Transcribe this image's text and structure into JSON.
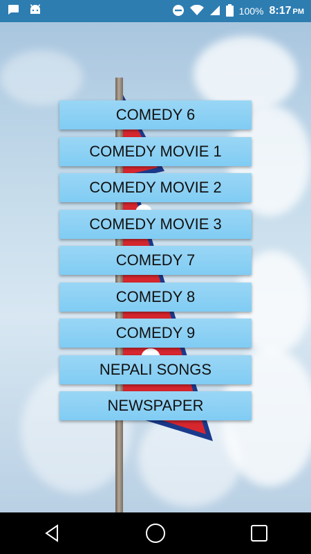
{
  "status_bar": {
    "left_icons": [
      "chat-icon",
      "android-icon"
    ],
    "right_icons": [
      "dnd-icon",
      "wifi-icon",
      "signal-icon",
      "battery-icon"
    ],
    "battery": "100%",
    "time": "8:17",
    "ampm": "PM"
  },
  "menu": {
    "items": [
      {
        "label": "COMEDY 6"
      },
      {
        "label": "COMEDY MOVIE 1"
      },
      {
        "label": "COMEDY MOVIE 2"
      },
      {
        "label": "COMEDY MOVIE 3"
      },
      {
        "label": "COMEDY 7"
      },
      {
        "label": "COMEDY 8"
      },
      {
        "label": "COMEDY 9"
      },
      {
        "label": "NEPALI SONGS"
      },
      {
        "label": "NEWSPAPER"
      }
    ]
  },
  "nav_bar": {
    "buttons": [
      "back-icon",
      "home-icon",
      "recents-icon"
    ]
  },
  "colors": {
    "status_bar": "#2d7db1",
    "button": "#8ad1f5",
    "flag_red": "#d7262e",
    "flag_blue": "#1b3a8c"
  }
}
